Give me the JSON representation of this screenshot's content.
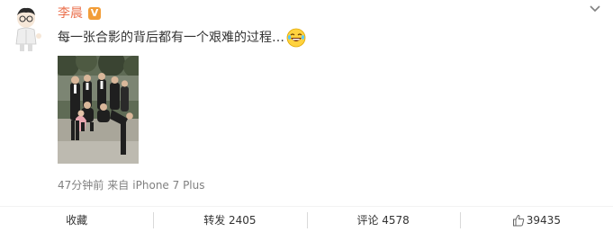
{
  "user": {
    "name": "李晨",
    "verified_badge": "V",
    "name_color": "#eb7350",
    "badge_color": "#f29d38"
  },
  "post": {
    "text": "每一张合影的背后都有一个艰难的过程…",
    "emoji_icon": "laughing-tears-emoji",
    "photo": "group-photo"
  },
  "meta": {
    "time": "47分钟前",
    "source_prefix": "来自",
    "source": "iPhone 7 Plus"
  },
  "actions": {
    "favorite_label": "收藏",
    "repost_label": "转发 2405",
    "comment_label": "评论 4578",
    "like_count": "39435",
    "like_icon": "thumbs-up-icon"
  },
  "menu_icon": "chevron-down-icon"
}
